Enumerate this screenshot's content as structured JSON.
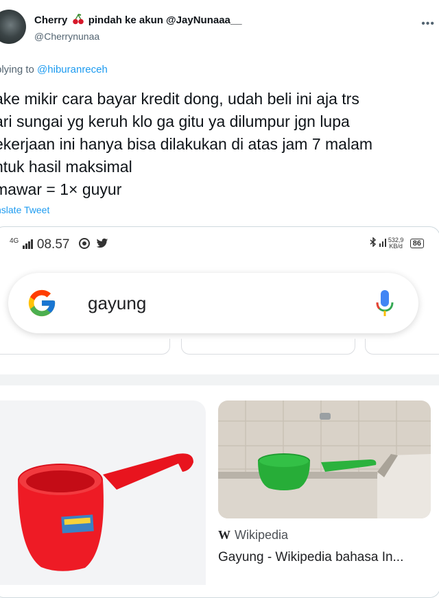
{
  "tweet": {
    "display_name_part1": "Cherry",
    "display_name_part2": "pindah ke akun @JayNunaaa__",
    "handle": "@Cherrynunaa",
    "replying_prefix": "plying to",
    "replying_handle": "@hiburanreceh",
    "text": "ake mikir cara bayar kredit dong, udah beli ini aja trs\nari sungai yg keruh klo ga gitu ya dilumpur jgn lupa\nekerjaan ini hanya bisa dilakukan di atas jam 7 malam\nntuk hasil maksimal\nmawar = 1× guyur",
    "translate_label": "nslate Tweet"
  },
  "phone": {
    "network": "4G",
    "time": "08.57",
    "speed": "532,9",
    "speed_unit": "KB/d",
    "battery": "86"
  },
  "search": {
    "query": "gayung"
  },
  "results": {
    "wiki_source": "Wikipedia",
    "wiki_title": "Gayung - Wikipedia bahasa In..."
  },
  "colors": {
    "twitter_blue": "#1d9bf0",
    "scoop_red": "#e8141e",
    "scoop_green": "#22b33a"
  }
}
